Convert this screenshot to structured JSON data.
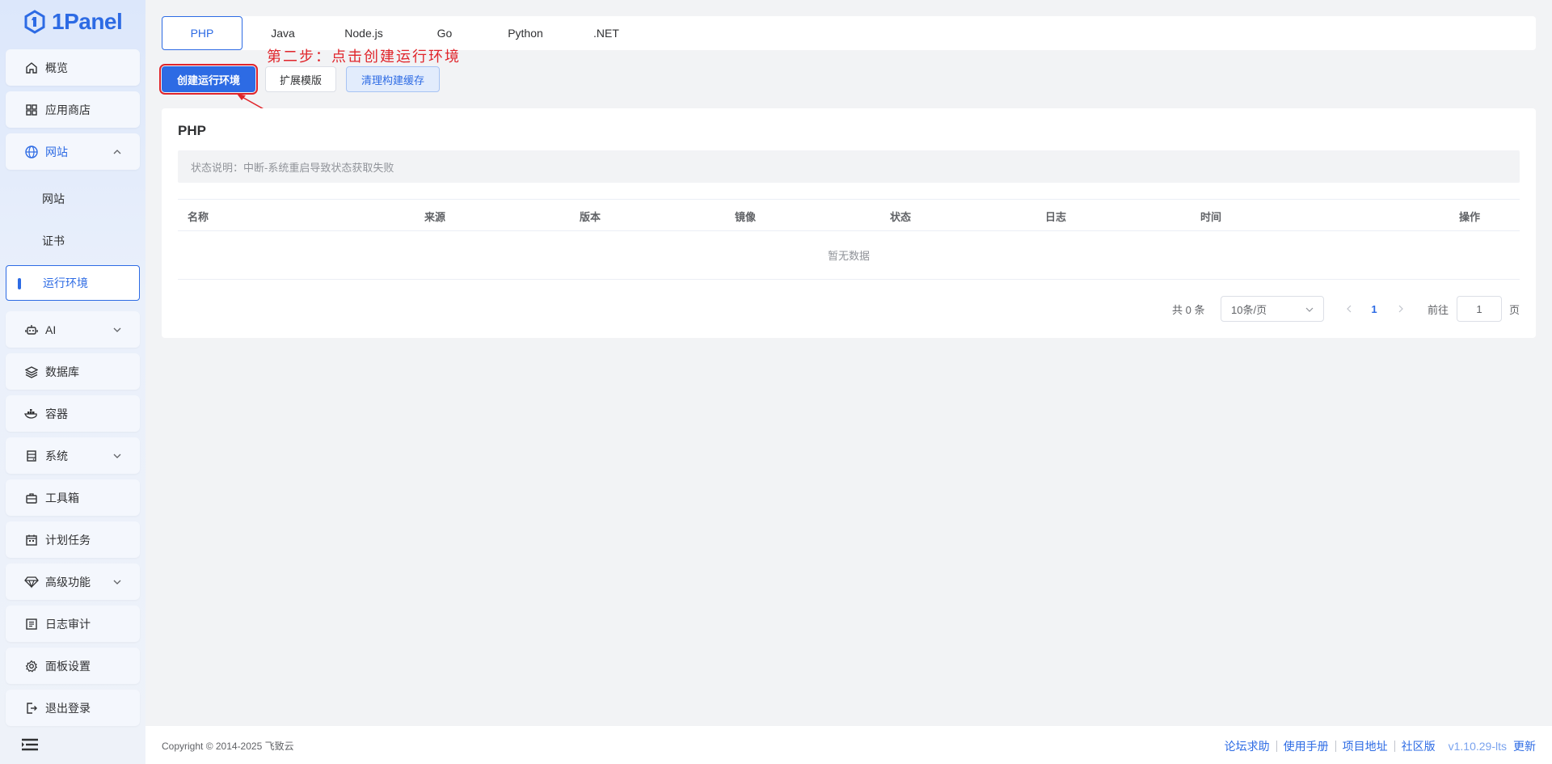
{
  "app": {
    "logo_text": "1Panel"
  },
  "sidebar": {
    "items": [
      {
        "label": "概览",
        "icon": "home-icon"
      },
      {
        "label": "应用商店",
        "icon": "grid-icon"
      },
      {
        "label": "网站",
        "icon": "globe-icon",
        "expanded": true
      },
      {
        "label": "AI",
        "icon": "robot-icon"
      },
      {
        "label": "数据库",
        "icon": "layers-icon"
      },
      {
        "label": "容器",
        "icon": "docker-icon"
      },
      {
        "label": "系统",
        "icon": "server-icon"
      },
      {
        "label": "工具箱",
        "icon": "toolbox-icon"
      },
      {
        "label": "计划任务",
        "icon": "calendar-icon"
      },
      {
        "label": "高级功能",
        "icon": "diamond-icon"
      },
      {
        "label": "日志审计",
        "icon": "log-icon"
      },
      {
        "label": "面板设置",
        "icon": "gear-icon"
      },
      {
        "label": "退出登录",
        "icon": "logout-icon"
      }
    ],
    "sub_items": [
      {
        "label": "网站"
      },
      {
        "label": "证书"
      },
      {
        "label": "运行环境",
        "active": true
      }
    ]
  },
  "tabs": [
    {
      "label": "PHP",
      "active": true
    },
    {
      "label": "Java"
    },
    {
      "label": "Node.js"
    },
    {
      "label": "Go"
    },
    {
      "label": "Python"
    },
    {
      "label": ".NET"
    }
  ],
  "toolbar": {
    "create_label": "创建运行环境",
    "extend_label": "扩展模版",
    "clean_label": "清理构建缓存"
  },
  "annotation": {
    "text": "第二步：点击创建运行环境",
    "color": "#e0252b"
  },
  "panel": {
    "title": "PHP",
    "status_note": "状态说明：中断-系统重启导致状态获取失败",
    "columns": [
      "名称",
      "来源",
      "版本",
      "镜像",
      "状态",
      "日志",
      "时间",
      "操作"
    ],
    "empty_text": "暂无数据"
  },
  "pagination": {
    "total_label": "共 0 条",
    "page_size": "10条/页",
    "current_page": "1",
    "goto_label": "前往",
    "goto_value": "1",
    "page_suffix": "页"
  },
  "footer": {
    "copyright": "Copyright © 2014-2025 飞致云",
    "links": [
      "论坛求助",
      "使用手册",
      "项目地址",
      "社区版"
    ],
    "version": "v1.10.29-lts",
    "update_label": "更新"
  },
  "colors": {
    "accent": "#2d6be4",
    "annotation": "#e0252b"
  }
}
